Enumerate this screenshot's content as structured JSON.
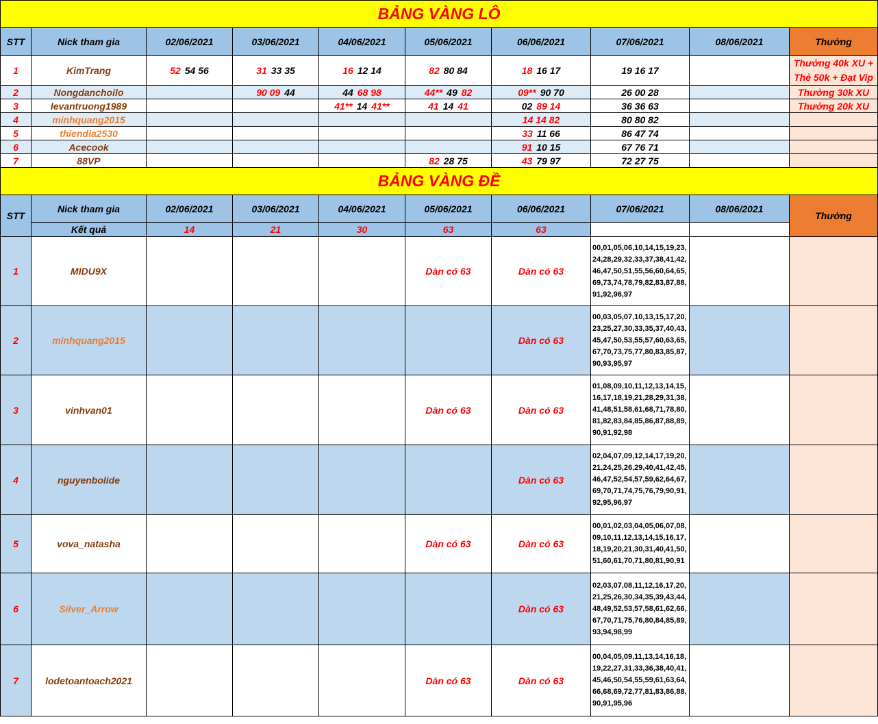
{
  "lo": {
    "title": "BẢNG VÀNG LÔ",
    "headers": [
      "STT",
      "Nick tham gia",
      "02/06/2021",
      "03/06/2021",
      "04/06/2021",
      "05/06/2021",
      "06/06/2021",
      "07/06/2021",
      "08/06/2021",
      "Thưởng"
    ],
    "rows": [
      {
        "stt": "1",
        "nick": "KimTrang",
        "c1r": "52",
        "c1k": "54 56",
        "c2r": "31",
        "c2k": "33 35",
        "c3r": "16",
        "c3k": "12 14",
        "c4r": "82",
        "c4k": "80 84",
        "c5r": "18",
        "c5k": "16 17",
        "c6": "19 16 17",
        "reward1": "Thưởng 40k XU +",
        "reward2": "Thẻ 50k + Đạt Vip"
      },
      {
        "stt": "2",
        "nick": "Nongdanchoilo",
        "c2r": "90 09",
        "c2k": "44",
        "c3k": "44",
        "c3r": "68 98",
        "c4r": "44**",
        "c4k": "49",
        "c4r2": "82",
        "c5r": "09**",
        "c5k": "90 70",
        "c6": "26 00 28",
        "reward": "Thưởng 30k XU"
      },
      {
        "stt": "3",
        "nick": "levantruong1989",
        "c3r": "41**",
        "c3k": "14",
        "c3r2": "41**",
        "c4r": "41",
        "c4k": "14",
        "c4r2": "41",
        "c5k": "02",
        "c5r": "89 14",
        "c6": "36 36 63",
        "reward": "Thưởng 20k XU"
      },
      {
        "stt": "4",
        "nick": "minhquang2015",
        "c5r": "14 14 82",
        "c6": "80 80 82"
      },
      {
        "stt": "5",
        "nick": "thiendia2530",
        "c5r": "33",
        "c5k": "11 66",
        "c6": "86 47 74"
      },
      {
        "stt": "6",
        "nick": "Acecook",
        "c5r": "91",
        "c5k": "10 15",
        "c6": "67 76 71"
      },
      {
        "stt": "7",
        "nick": "88VP",
        "c4r": "82",
        "c4k": "28 75",
        "c5r": "43",
        "c5k": "79 97",
        "c6": "72 27 75"
      }
    ]
  },
  "de": {
    "title": "BẢNG VÀNG ĐỀ",
    "headers": [
      "STT",
      "Nick tham gia",
      "02/06/2021",
      "03/06/2021",
      "04/06/2021",
      "05/06/2021",
      "06/06/2021",
      "07/06/2021",
      "08/06/2021",
      "Thưởng"
    ],
    "result_label": "Kết quả",
    "results": [
      "14",
      "21",
      "30",
      "63",
      "63"
    ],
    "dan_label": "Dàn có 63",
    "rows": [
      {
        "stt": "1",
        "nick": "MIDU9X",
        "d5": "Dàn có 63",
        "d6": "Dàn có 63",
        "d7": "00,01,05,06,10,14,15,19,23,24,28,29,32,33,37,38,41,42,46,47,50,51,55,56,60,64,65,69,73,74,78,79,82,83,87,88,91,92,96,97"
      },
      {
        "stt": "2",
        "nick": "minhquang2015",
        "d6": "Dàn có 63",
        "d7": "00,03,05,07,10,13,15,17,20,23,25,27,30,33,35,37,40,43,45,47,50,53,55,57,60,63,65,67,70,73,75,77,80,83,85,87,90,93,95,97"
      },
      {
        "stt": "3",
        "nick": "vinhvan01",
        "d5": "Dàn có 63",
        "d6": "Dàn có 63",
        "d7": "01,08,09,10,11,12,13,14,15,16,17,18,19,21,28,29,31,38,41,48,51,58,61,68,71,78,80,81,82,83,84,85,86,87,88,89,90,91,92,98"
      },
      {
        "stt": "4",
        "nick": "nguyenbolide",
        "d6": "Dàn có 63",
        "d7": "02,04,07,09,12,14,17,19,20,21,24,25,26,29,40,41,42,45,46,47,52,54,57,59,62,64,67,69,70,71,74,75,76,79,90,91,92,95,96,97"
      },
      {
        "stt": "5",
        "nick": "vova_natasha",
        "d5": "Dàn có 63",
        "d6": "Dàn có 63",
        "d7": "00,01,02,03,04,05,06,07,08,09,10,11,12,13,14,15,16,17,18,19,20,21,30,31,40,41,50,51,60,61,70,71,80,81,90,91"
      },
      {
        "stt": "6",
        "nick": "Silver_Arrow",
        "d6": "Dàn có 63",
        "d7": "02,03,07,08,11,12,16,17,20,21,25,26,30,34,35,39,43,44,48,49,52,53,57,58,61,62,66,67,70,71,75,76,80,84,85,89,93,94,98,99"
      },
      {
        "stt": "7",
        "nick": "lodetoantoach2021",
        "d5": "Dàn có 63",
        "d6": "Dàn có 63",
        "d7": "00,04,05,09,11,13,14,16,18,19,22,27,31,33,36,38,40,41,45,46,50,54,55,59,61,63,64,66,68,69,72,77,81,83,86,88,90,91,95,96"
      }
    ]
  },
  "colors": {
    "banner": "#ffff00",
    "header": "#9dc3e6",
    "reward_header": "#ed7d31",
    "reward_cell": "#fce4d6",
    "alt_row": "#bdd7ee",
    "red": "#ff0000",
    "brown": "#843c0c",
    "orange": "#ed7d31"
  }
}
